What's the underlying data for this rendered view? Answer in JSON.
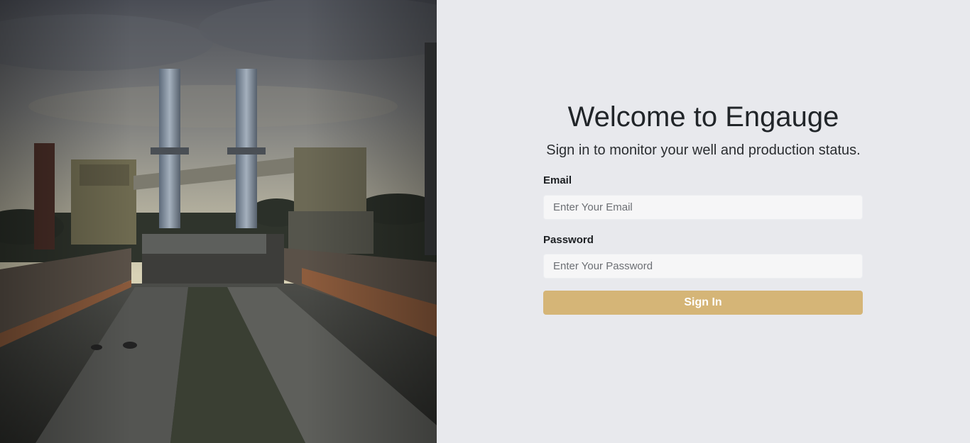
{
  "hero": {
    "image_description_icon": "industrial-plant-photo"
  },
  "login": {
    "title": "Welcome to Engauge",
    "subtitle": "Sign in to monitor your well and production status.",
    "email_label": "Email",
    "email_placeholder": "Enter Your Email",
    "email_value": "",
    "password_label": "Password",
    "password_placeholder": "Enter Your Password",
    "password_value": "",
    "submit_label": "Sign In"
  },
  "colors": {
    "background": "#e8e9ed",
    "button": "#d5b577",
    "input_bg": "#f6f6f7",
    "text": "#212529"
  }
}
